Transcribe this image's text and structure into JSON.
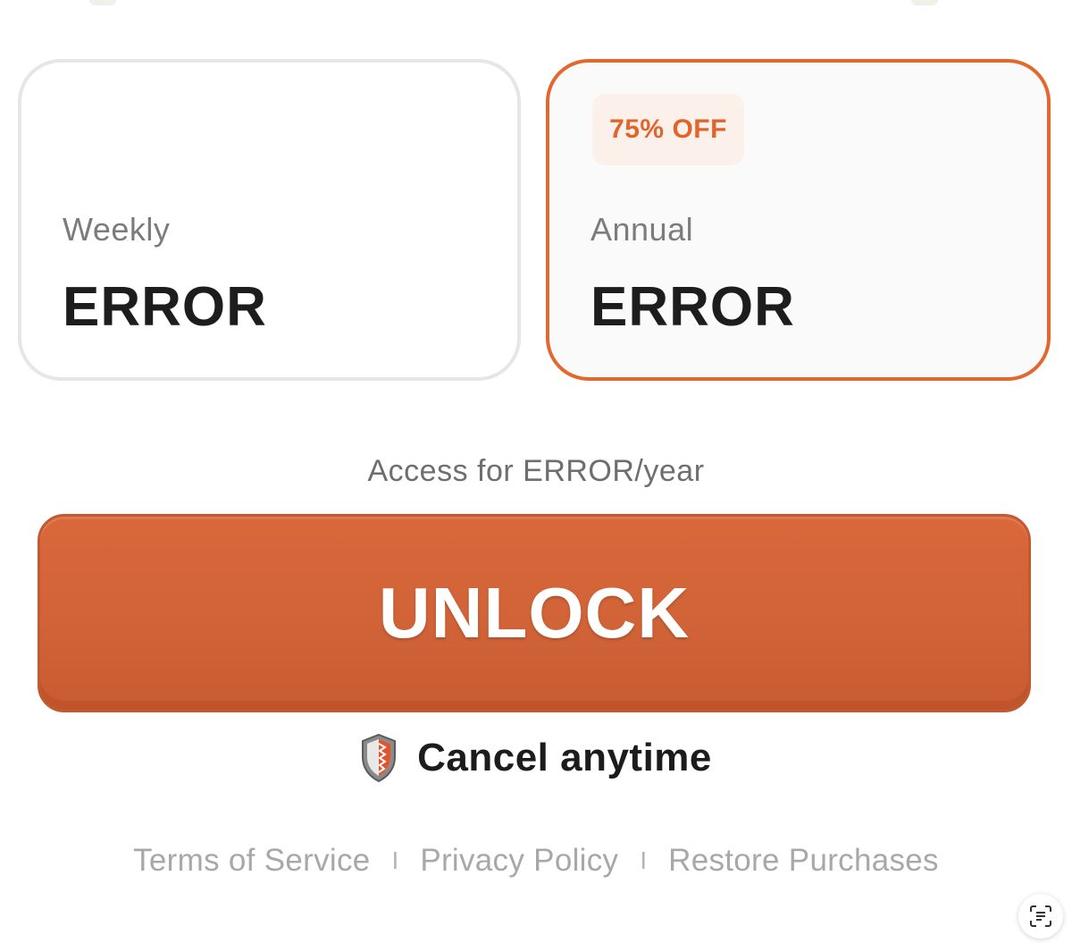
{
  "plans": {
    "weekly": {
      "period": "Weekly",
      "price": "ERROR"
    },
    "annual": {
      "badge": "75% OFF",
      "period": "Annual",
      "price": "ERROR",
      "selected": true
    }
  },
  "access_text": "Access for ERROR/year",
  "unlock_button": {
    "label": "UNLOCK"
  },
  "cancel": {
    "text": "Cancel anytime",
    "icon": "shield-icon"
  },
  "footer": {
    "terms": "Terms of Service",
    "privacy": "Privacy Policy",
    "restore": "Restore Purchases",
    "separator": "I"
  },
  "colors": {
    "accent": "#e3682f",
    "button": "#d16338",
    "badge_bg": "#fcf1ea"
  }
}
